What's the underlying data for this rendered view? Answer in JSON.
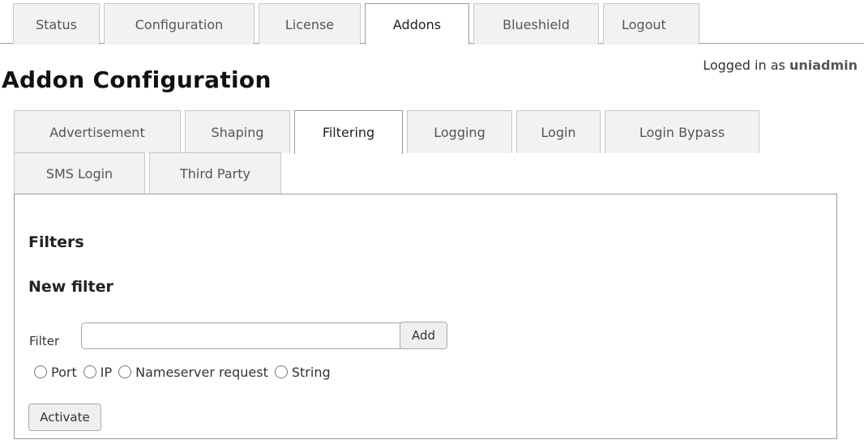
{
  "top_tabs": [
    {
      "label": "Status"
    },
    {
      "label": "Configuration"
    },
    {
      "label": "License"
    },
    {
      "label": "Addons"
    },
    {
      "label": "Blueshield"
    },
    {
      "label": "Logout"
    }
  ],
  "logged_in": {
    "prefix": "Logged in as",
    "user": "uniadmin"
  },
  "page_title": "Addon Configuration",
  "sub_tabs": [
    {
      "label": "Advertisement"
    },
    {
      "label": "Shaping"
    },
    {
      "label": "Filtering"
    },
    {
      "label": "Logging"
    },
    {
      "label": "Login"
    },
    {
      "label": "Login Bypass"
    },
    {
      "label": "SMS Login"
    },
    {
      "label": "Third Party"
    }
  ],
  "active_top_tab": "Addons",
  "active_sub_tab": "Filtering",
  "panel": {
    "filters_heading": "Filters",
    "new_filter_heading": "New filter",
    "filter_label": "Filter",
    "filter_value": "",
    "add_button": "Add",
    "radio_options": [
      {
        "label": "Port",
        "checked": false
      },
      {
        "label": "IP",
        "checked": false
      },
      {
        "label": "Nameserver request",
        "checked": false
      },
      {
        "label": "String",
        "checked": false
      }
    ],
    "activate_button": "Activate"
  }
}
